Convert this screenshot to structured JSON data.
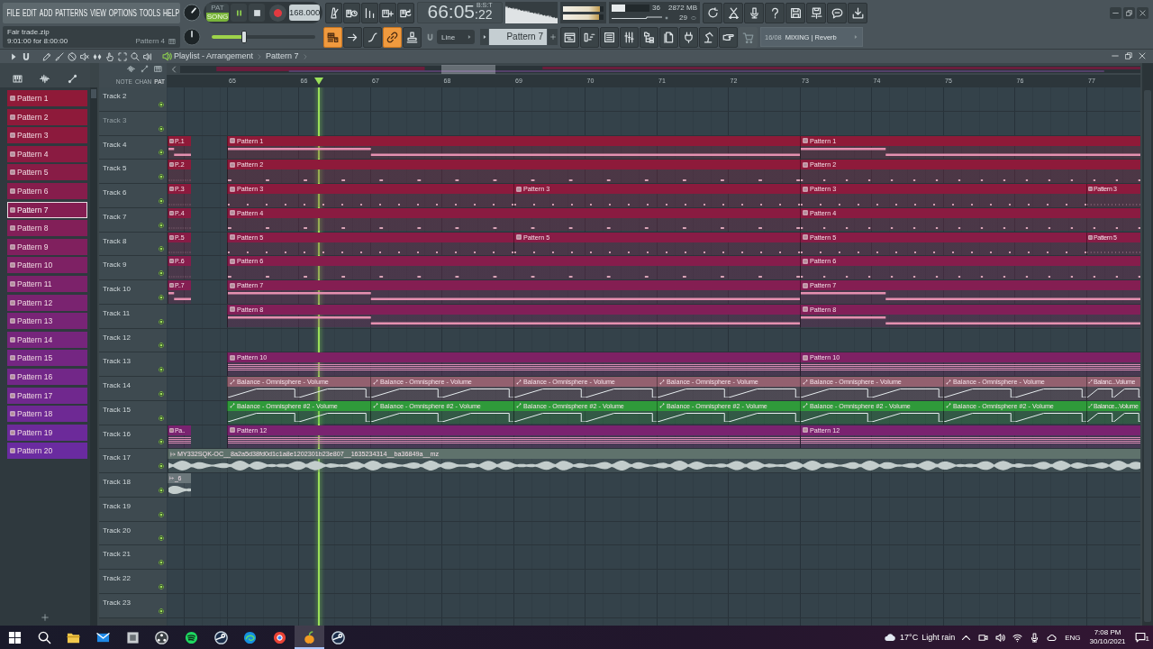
{
  "menu": [
    "FILE",
    "EDIT",
    "ADD",
    "PATTERNS",
    "VIEW",
    "OPTIONS",
    "TOOLS",
    "HELP"
  ],
  "project": {
    "file": "Fair trade.zip",
    "duration": "9:01:00 for 8:00:00",
    "pattern": "Pattern 4"
  },
  "knobs": [
    {
      "level": 0.65
    },
    {
      "level": 0.5
    }
  ],
  "transport": {
    "modes": [
      {
        "label": "PAT",
        "selected": false
      },
      {
        "label": "SONG",
        "selected": true
      }
    ],
    "playing": true,
    "tempo": "168.000"
  },
  "song_position": {
    "level": 0.31
  },
  "clock": {
    "main": "66:05",
    "sub": ":22",
    "format": "B:S:T"
  },
  "output_meter": [
    {
      "level": 0.9
    },
    {
      "level": 0.88
    }
  ],
  "monitor": {
    "level": 0.36,
    "cpu": "36",
    "memory": "2872 MB",
    "polyphony": "29"
  },
  "tool_buttons": [
    {
      "on": true
    },
    {
      "on": false
    },
    {
      "on": false
    },
    {
      "on": true
    },
    {
      "on": false
    }
  ],
  "snap": {
    "value": "Line"
  },
  "pattern_selector": {
    "value": "Pattern 7"
  },
  "hint": {
    "code": "16/08",
    "text": "MIXING | Reverb"
  },
  "playlist": {
    "title": "Playlist - Arrangement",
    "pattern": "Pattern 7",
    "picker_tabs": [
      {
        "label": "NOTE",
        "selected": false
      },
      {
        "label": "CHAN",
        "selected": false
      },
      {
        "label": "PAT",
        "selected": true
      }
    ],
    "bars": [
      "65",
      "66",
      "67",
      "68",
      "69",
      "70",
      "71",
      "72",
      "73",
      "74",
      "75",
      "76",
      "77"
    ]
  },
  "patterns": [
    {
      "label": "Pattern 1",
      "color": "#8f1a38",
      "selected": false
    },
    {
      "label": "Pattern 2",
      "color": "#8e1a3a",
      "selected": false
    },
    {
      "label": "Pattern 3",
      "color": "#8c1a3d",
      "selected": false
    },
    {
      "label": "Pattern 4",
      "color": "#8a1b41",
      "selected": false
    },
    {
      "label": "Pattern 5",
      "color": "#881c46",
      "selected": false
    },
    {
      "label": "Pattern 6",
      "color": "#861d4c",
      "selected": false
    },
    {
      "label": "Pattern 7",
      "color": "#841e52",
      "selected": true
    },
    {
      "label": "Pattern 8",
      "color": "#821f58",
      "selected": false
    },
    {
      "label": "Pattern 9",
      "color": "#80205e",
      "selected": false
    },
    {
      "label": "Pattern 10",
      "color": "#7e2164",
      "selected": false
    },
    {
      "label": "Pattern 11",
      "color": "#7c226a",
      "selected": false
    },
    {
      "label": "Pattern 12",
      "color": "#7a2370",
      "selected": false
    },
    {
      "label": "Pattern 13",
      "color": "#782476",
      "selected": false
    },
    {
      "label": "Pattern 14",
      "color": "#76257c",
      "selected": false
    },
    {
      "label": "Pattern 15",
      "color": "#742682",
      "selected": false
    },
    {
      "label": "Pattern 16",
      "color": "#722788",
      "selected": false
    },
    {
      "label": "Pattern 17",
      "color": "#70288e",
      "selected": false
    },
    {
      "label": "Pattern 18",
      "color": "#6e2994",
      "selected": false
    },
    {
      "label": "Pattern 19",
      "color": "#6c2a9a",
      "selected": false
    },
    {
      "label": "Pattern 20",
      "color": "#6a2ba0",
      "selected": false
    }
  ],
  "tracks": [
    {
      "name": "Track 2",
      "disabled": false
    },
    {
      "name": "Track 3",
      "disabled": true
    },
    {
      "name": "Track 4",
      "disabled": false,
      "lead": {
        "label": "P..1",
        "color": "#8f1a38",
        "kind": "notes"
      },
      "clips": [
        {
          "label": "Pattern 1",
          "color": "#8f1a38",
          "kind": "notes"
        },
        {
          "label": "Pattern 1",
          "color": "#8f1a38",
          "kind": "notes"
        }
      ]
    },
    {
      "name": "Track 5",
      "disabled": false,
      "lead": {
        "label": "P..2",
        "color": "#8e1a3a",
        "kind": "hits"
      },
      "clips": [
        {
          "label": "Pattern 2",
          "color": "#8e1a3a",
          "kind": "hits"
        },
        {
          "label": "Pattern 2",
          "color": "#8e1a3a",
          "kind": "hits"
        }
      ]
    },
    {
      "name": "Track 6",
      "disabled": false,
      "lead": {
        "label": "P..3",
        "color": "#8c1a3d",
        "kind": "hits"
      },
      "clips": [
        {
          "label": "Pattern 3",
          "color": "#8c1a3d",
          "kind": "hits"
        },
        {
          "label": "Pattern 3",
          "color": "#8c1a3d",
          "kind": "hits"
        },
        {
          "label": "Pattern 3",
          "color": "#8c1a3d",
          "kind": "hits"
        },
        {
          "label": "Pattern 3",
          "color": "#8c1a3d",
          "kind": "hits"
        }
      ]
    },
    {
      "name": "Track 7",
      "disabled": false,
      "lead": {
        "label": "P..4",
        "color": "#8a1b41",
        "kind": "hits"
      },
      "clips": [
        {
          "label": "Pattern 4",
          "color": "#8a1b41",
          "kind": "hits"
        },
        {
          "label": "Pattern 4",
          "color": "#8a1b41",
          "kind": "hits"
        }
      ]
    },
    {
      "name": "Track 8",
      "disabled": false,
      "lead": {
        "label": "P..5",
        "color": "#881c46",
        "kind": "hits"
      },
      "clips": [
        {
          "label": "Pattern 5",
          "color": "#881c46",
          "kind": "hits"
        },
        {
          "label": "Pattern 5",
          "color": "#881c46",
          "kind": "hits"
        },
        {
          "label": "Pattern 5",
          "color": "#881c46",
          "kind": "hits"
        },
        {
          "label": "Pattern 5",
          "color": "#881c46",
          "kind": "hits"
        }
      ]
    },
    {
      "name": "Track 9",
      "disabled": false,
      "lead": {
        "label": "P..6",
        "color": "#861d4c",
        "kind": "hits"
      },
      "clips": [
        {
          "label": "Pattern 6",
          "color": "#861d4c",
          "kind": "hits"
        },
        {
          "label": "Pattern 6",
          "color": "#861d4c",
          "kind": "hits"
        }
      ]
    },
    {
      "name": "Track 10",
      "disabled": false,
      "lead": {
        "label": "P..7",
        "color": "#841e52",
        "kind": "notes"
      },
      "clips": [
        {
          "label": "Pattern 7",
          "color": "#841e52",
          "kind": "notes"
        },
        {
          "label": "Pattern 7",
          "color": "#841e52",
          "kind": "notes"
        }
      ]
    },
    {
      "name": "Track 11",
      "disabled": false,
      "clips": [
        {
          "label": "Pattern 8",
          "color": "#821f58",
          "kind": "notes"
        },
        {
          "label": "Pattern 8",
          "color": "#821f58",
          "kind": "notes"
        }
      ]
    },
    {
      "name": "Track 12",
      "disabled": false
    },
    {
      "name": "Track 13",
      "disabled": false,
      "clips": [
        {
          "label": "Pattern 10",
          "color": "#7e2164",
          "kind": "chords"
        },
        {
          "label": "Pattern 10",
          "color": "#7e2164",
          "kind": "chords"
        }
      ]
    },
    {
      "name": "Track 14",
      "disabled": false,
      "clips": [
        {
          "label": "Balance - Omnisphere - Volume",
          "color": "#93606f",
          "kind": "automation"
        },
        {
          "label": "Balance - Omnisphere - Volume",
          "color": "#93606f",
          "kind": "automation"
        },
        {
          "label": "Balance - Omnisphere - Volume",
          "color": "#93606f",
          "kind": "automation"
        },
        {
          "label": "Balance - Omnisphere - Volume",
          "color": "#93606f",
          "kind": "automation"
        },
        {
          "label": "Balance - Omnisphere - Volume",
          "color": "#93606f",
          "kind": "automation"
        },
        {
          "label": "Balance - Omnisphere - Volume",
          "color": "#93606f",
          "kind": "automation"
        },
        {
          "label": "Balanc...Volume",
          "color": "#93606f",
          "kind": "automation"
        }
      ]
    },
    {
      "name": "Track 15",
      "disabled": false,
      "clips": [
        {
          "label": "Balance - Omnisphere #2 - Volume",
          "color": "#2f9a3a",
          "kind": "automation"
        },
        {
          "label": "Balance - Omnisphere #2 - Volume",
          "color": "#2f9a3a",
          "kind": "automation"
        },
        {
          "label": "Balance - Omnisphere #2 - Volume",
          "color": "#2f9a3a",
          "kind": "automation"
        },
        {
          "label": "Balance - Omnisphere #2 - Volume",
          "color": "#2f9a3a",
          "kind": "automation"
        },
        {
          "label": "Balance - Omnisphere #2 - Volume",
          "color": "#2f9a3a",
          "kind": "automation"
        },
        {
          "label": "Balance - Omnisphere #2 - Volume",
          "color": "#2f9a3a",
          "kind": "automation"
        },
        {
          "label": "Balance...Volume",
          "color": "#2f9a3a",
          "kind": "automation"
        }
      ]
    },
    {
      "name": "Track 16",
      "disabled": false,
      "lead": {
        "label": "Pa..",
        "color": "#7a2370",
        "kind": "chords"
      },
      "clips": [
        {
          "label": "Pattern 12",
          "color": "#7a2370",
          "kind": "chords"
        },
        {
          "label": "Pattern 12",
          "color": "#7a2370",
          "kind": "chords"
        }
      ]
    },
    {
      "name": "Track 17",
      "disabled": false,
      "clips": [
        {
          "label": "MY332SQK-OC__8a2a5d38fd0d1c1a8e1202301b23e807__1635234314__ba36849a__mz",
          "color": "#5f726c",
          "kind": "audio"
        }
      ]
    },
    {
      "name": "Track 18",
      "disabled": false,
      "lead": {
        "label": "_6",
        "color": "#6b777b",
        "kind": "audio"
      }
    },
    {
      "name": "Track 19",
      "disabled": false
    },
    {
      "name": "Track 20",
      "disabled": false
    },
    {
      "name": "Track 21",
      "disabled": false
    },
    {
      "name": "Track 22",
      "disabled": false
    },
    {
      "name": "Track 23",
      "disabled": false
    }
  ],
  "taskbar": {
    "apps": [
      {
        "selected": false
      },
      {
        "selected": false
      },
      {
        "selected": false
      },
      {
        "selected": false
      },
      {
        "selected": false
      },
      {
        "selected": false
      },
      {
        "selected": false
      },
      {
        "selected": false
      },
      {
        "selected": false
      },
      {
        "selected": false
      },
      {
        "selected": true
      },
      {
        "selected": false
      }
    ],
    "temperature": "17°C",
    "condition": "Light rain",
    "language": "ENG",
    "time": "7:08 PM",
    "date": "30/10/2021",
    "notifications": "1"
  }
}
